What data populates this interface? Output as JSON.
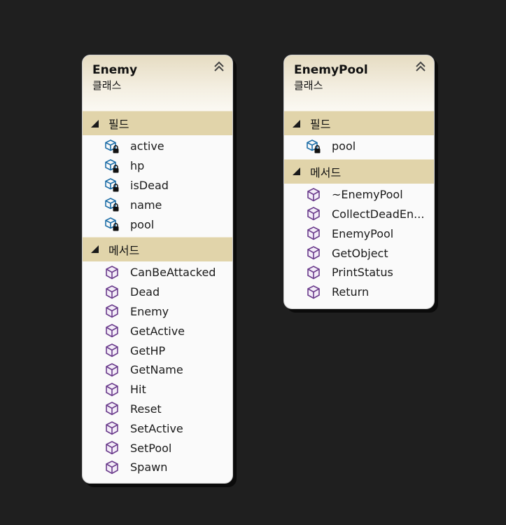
{
  "classes": [
    {
      "title": "Enemy",
      "subtitle": "클래스",
      "fields_label": "필드",
      "fields": [
        "active",
        "hp",
        "isDead",
        "name",
        "pool"
      ],
      "methods_label": "메서드",
      "methods": [
        "CanBeAttacked",
        "Dead",
        "Enemy",
        "GetActive",
        "GetHP",
        "GetName",
        "Hit",
        "Reset",
        "SetActive",
        "SetPool",
        "Spawn"
      ]
    },
    {
      "title": "EnemyPool",
      "subtitle": "클래스",
      "fields_label": "필드",
      "fields": [
        "pool"
      ],
      "methods_label": "메서드",
      "methods": [
        "~EnemyPool",
        "CollectDeadEn...",
        "EnemyPool",
        "GetObject",
        "PrintStatus",
        "Return"
      ]
    }
  ],
  "icons": {
    "field": "private-field-icon",
    "method": "method-icon",
    "collapse": "collapse-chevrons-icon",
    "section_toggle": "expanded-triangle-icon"
  },
  "colors": {
    "background": "#1f1f1f",
    "header_gradient": "#e6dcc2",
    "section_bar": "#e1d4aa",
    "field_icon": "#1f6fa8",
    "method_icon": "#6b3c8c"
  }
}
